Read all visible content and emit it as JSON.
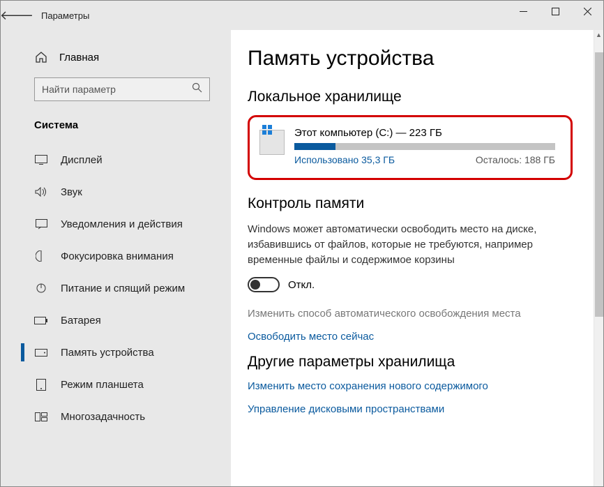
{
  "titlebar": {
    "title": "Параметры"
  },
  "sidebar": {
    "home": "Главная",
    "search_placeholder": "Найти параметр",
    "category": "Система",
    "items": [
      {
        "label": "Дисплей"
      },
      {
        "label": "Звук"
      },
      {
        "label": "Уведомления и действия"
      },
      {
        "label": "Фокусировка внимания"
      },
      {
        "label": "Питание и спящий режим"
      },
      {
        "label": "Батарея"
      },
      {
        "label": "Память устройства"
      },
      {
        "label": "Режим планшета"
      },
      {
        "label": "Многозадачность"
      }
    ]
  },
  "main": {
    "page_title": "Память устройства",
    "local_storage": {
      "title": "Локальное хранилище",
      "drive_name": "Этот компьютер (C:) — 223 ГБ",
      "used": "Использовано 35,3 ГБ",
      "remaining": "Осталось: 188 ГБ"
    },
    "storage_sense": {
      "title": "Контроль памяти",
      "desc": "Windows может автоматически освободить место на диске, избавившись от файлов, которые не требуются, например временные файлы и содержимое корзины",
      "toggle_state": "Откл.",
      "change_link": "Изменить способ автоматического освобождения места",
      "free_now": "Освободить место сейчас"
    },
    "other": {
      "title": "Другие параметры хранилища",
      "where_link": "Изменить место сохранения нового содержимого",
      "spaces_link": "Управление дисковыми пространствами"
    }
  }
}
